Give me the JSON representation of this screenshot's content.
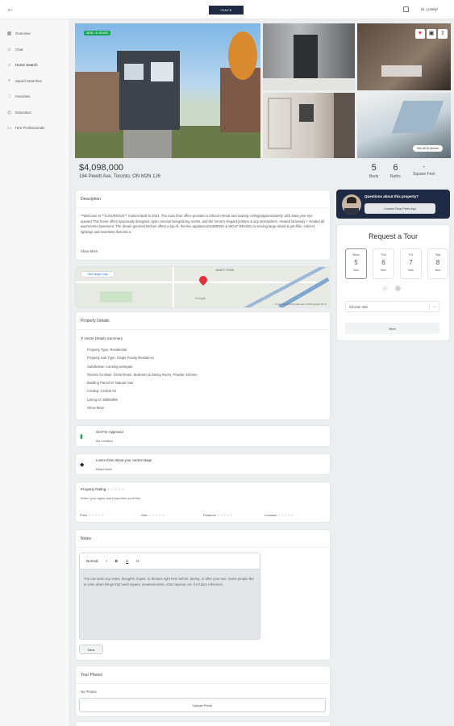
{
  "header": {
    "logo": "ISAKS",
    "user": "Hi, Lovely!"
  },
  "sidebar": {
    "items": [
      {
        "label": "Overview",
        "icon": "grid-icon"
      },
      {
        "label": "Chat",
        "icon": "people-icon"
      },
      {
        "label": "Home Search",
        "icon": "home-icon"
      },
      {
        "label": "Saved Searches",
        "icon": "search-icon"
      },
      {
        "label": "Favorites",
        "icon": "heart-icon"
      },
      {
        "label": "Education",
        "icon": "education-icon"
      },
      {
        "label": "Hire Professionals",
        "icon": "briefcase-icon"
      }
    ]
  },
  "listing": {
    "badge": "NEW • 4 HOURS",
    "see_all": "See all 60 photos",
    "price": "$4,098,000",
    "address": "184 Pewitt Ave, Toronto, ON M2N 1J6",
    "beds": "5",
    "beds_label": "Beds",
    "baths": "6",
    "baths_label": "Baths",
    "sqft": "-",
    "sqft_label": "Square Feet"
  },
  "description": {
    "title": "Description",
    "text": "**Welcome to **LUXURIOUS** Custom-Built in 2024. The main floor office provides a refined retreat and soaring ceilings(approximately 11ft) draw your eye upward.This home offers spaciously designed, open concept living/dining rooms, and the home's elegant posture & airy atmosphere. Heated Driveway + Heated all washrooms basement. The dream gourmet kitchen offers a top-of- the-line appliance(SUBZERO & WOLF BRAND) Is serving large island & pot-filler, indirect lightings and seamless flow into a",
    "show_more": "Show More"
  },
  "map": {
    "button": "View larger map",
    "area_label": "JAMES TOWN",
    "google": "Google",
    "footer": "Keyboard shortcuts   Map data ©2024 Google   Terms"
  },
  "details": {
    "title": "Property Details",
    "summary_title": "Home Details Summary",
    "items": [
      "Property Type: Residential",
      "Property Sub Type: Single Family Residence",
      "Subdivision: Lansing-westgate",
      "Rooms On Main: Great Room, Bedroom & Dining Room, Powder, Kitchen",
      "Building Parcel Id: Natural Gas",
      "Cooling: Central Air",
      "Listing Id: 28850899"
    ],
    "show_more": "Show More"
  },
  "preapproval": {
    "title": "Get Pre-Approved",
    "action": "No Lenders"
  },
  "stage": {
    "title": "Lorem more about your current stage",
    "action": "Read more"
  },
  "rating": {
    "title": "Property Rating",
    "subtitle": "When your agent and properties you'll like",
    "categories": [
      "Price",
      "Size",
      "Features",
      "Location"
    ]
  },
  "notes": {
    "title": "Notes",
    "tools": [
      "Normal",
      "I",
      "B",
      "U",
      "H"
    ],
    "placeholder": "You can write any notes, thoughts, hopes, or dreams right here before, during, or after your tour. Some people like to write down things that need repairs, measurements, room layouts, etc. for future reference.",
    "save": "Save"
  },
  "photos": {
    "title": "Your Photos",
    "empty": "No Photos",
    "upload": "Upload Photo"
  },
  "agent": {
    "question": "Questions about this property?",
    "button": "Contact Real Peter Agn"
  },
  "tour": {
    "title": "Request a Tour",
    "days": [
      {
        "dow": "Wed",
        "date": "5",
        "month": "Nov"
      },
      {
        "dow": "Thu",
        "date": "6",
        "month": "Nov"
      },
      {
        "dow": "Fri",
        "date": "7",
        "month": "Nov"
      },
      {
        "dow": "Sat",
        "date": "8",
        "month": "Nov"
      }
    ],
    "time_placeholder": "Choose time",
    "next": "Next"
  },
  "colors": {
    "accent": "#1e2a44",
    "badge": "#1aa75a",
    "heart": "#e0333c",
    "pin": "#e0333c"
  }
}
